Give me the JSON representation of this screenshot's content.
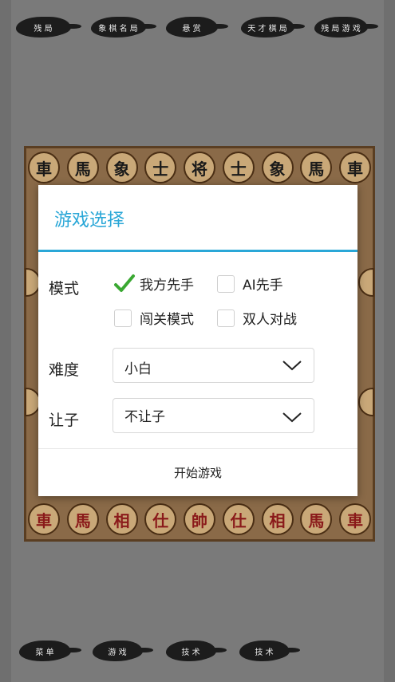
{
  "top_menu": [
    {
      "label": "残 局"
    },
    {
      "label": "象 棋 名 局"
    },
    {
      "label": "悬 赏"
    },
    {
      "label": "天 才 棋 局"
    },
    {
      "label": "残 局 游 戏"
    }
  ],
  "board": {
    "top_row": [
      "車",
      "馬",
      "象",
      "士",
      "将",
      "士",
      "象",
      "馬",
      "車"
    ],
    "bottom_row": [
      "車",
      "馬",
      "相",
      "仕",
      "帥",
      "仕",
      "相",
      "馬",
      "車"
    ]
  },
  "bottom_menu": [
    {
      "label": "菜 单"
    },
    {
      "label": "游 戏"
    },
    {
      "label": "技 术"
    },
    {
      "label": "技 术"
    }
  ],
  "dialog": {
    "title": "游戏选择",
    "mode_label": "模式",
    "mode_options": [
      {
        "label": "我方先手",
        "checked": true
      },
      {
        "label": "AI先手",
        "checked": false
      },
      {
        "label": "闯关模式",
        "checked": false
      },
      {
        "label": "双人对战",
        "checked": false
      }
    ],
    "difficulty_label": "难度",
    "difficulty_value": "小白",
    "handicap_label": "让子",
    "handicap_value": "不让子",
    "start_button": "开始游戏"
  },
  "colors": {
    "accent": "#2aa7d7",
    "check": "#3aa832"
  }
}
